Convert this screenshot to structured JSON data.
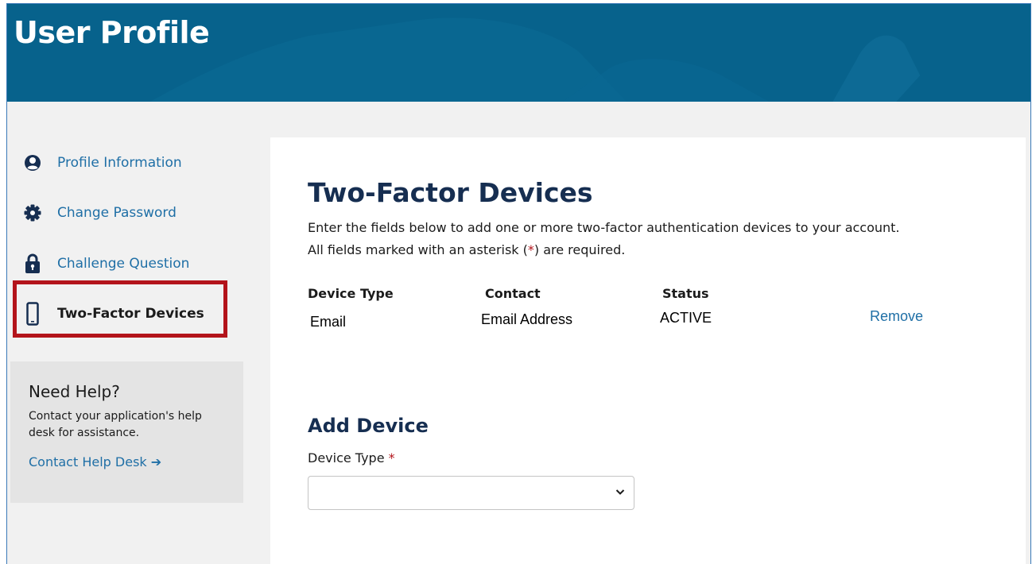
{
  "header": {
    "title": "User Profile"
  },
  "sidebar": {
    "items": [
      {
        "label": "Profile Information",
        "icon": "user-circle-icon"
      },
      {
        "label": "Change Password",
        "icon": "gear-icon"
      },
      {
        "label": "Challenge Question",
        "icon": "lock-icon"
      },
      {
        "label": "Two-Factor Devices",
        "icon": "mobile-phone-icon",
        "active": true
      }
    ],
    "active_highlight_color": "#b3141b"
  },
  "help": {
    "title": "Need Help?",
    "text": "Contact your application's help desk for assistance.",
    "link": "Contact Help Desk ➔"
  },
  "main": {
    "title": "Two-Factor Devices",
    "intro_line1": "Enter the fields below to add one or more two-factor authentication devices to your account.",
    "intro_line2_prefix": "All fields marked with an asterisk (",
    "asterisk": "*",
    "intro_line2_suffix": ") are required.",
    "table": {
      "headers": [
        "Device Type",
        "Contact",
        "Status"
      ],
      "rows": [
        {
          "device_type": "Email",
          "contact": "Email Address",
          "status": "ACTIVE",
          "action": "Remove"
        }
      ]
    },
    "add_device": {
      "title": "Add Device",
      "field_label": "Device Type",
      "required_mark": "*",
      "select_value": ""
    }
  },
  "colors": {
    "header_bg": "#07628c",
    "link": "#1f6fa6",
    "heading": "#162e51",
    "required": "#b3141b"
  }
}
